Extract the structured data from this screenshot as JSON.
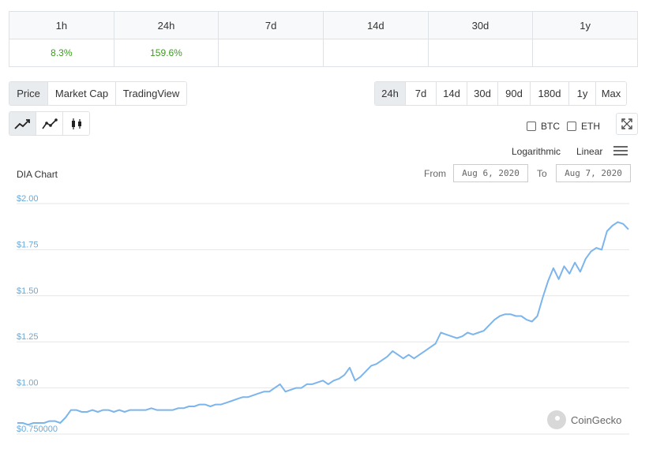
{
  "performance": {
    "headers": [
      "1h",
      "24h",
      "7d",
      "14d",
      "30d",
      "1y"
    ],
    "values": [
      "8.3%",
      "159.6%",
      "",
      "",
      "",
      ""
    ],
    "positive_color": "#3c9c1f"
  },
  "tabs": [
    {
      "label": "Price",
      "active": true
    },
    {
      "label": "Market Cap",
      "active": false
    },
    {
      "label": "TradingView",
      "active": false
    }
  ],
  "ranges": [
    {
      "label": "24h",
      "active": true
    },
    {
      "label": "7d",
      "active": false
    },
    {
      "label": "14d",
      "active": false
    },
    {
      "label": "30d",
      "active": false
    },
    {
      "label": "90d",
      "active": false
    },
    {
      "label": "180d",
      "active": false
    },
    {
      "label": "1y",
      "active": false
    },
    {
      "label": "Max",
      "active": false
    }
  ],
  "chart_types": [
    "line-chart-icon",
    "line-markers-icon",
    "candlestick-icon"
  ],
  "compare": {
    "btc_label": "BTC",
    "eth_label": "ETH"
  },
  "scale": {
    "log_label": "Logarithmic",
    "linear_label": "Linear"
  },
  "chart_title": "DIA Chart",
  "range": {
    "from_label": "From",
    "from_value": "Aug 6, 2020",
    "to_label": "To",
    "to_value": "Aug 7, 2020"
  },
  "brand": "CoinGecko",
  "chart_data": {
    "type": "line",
    "title": "DIA Chart",
    "line_color": "#7cb5ec",
    "axis_label_color": "#6aa9d8",
    "ylim": [
      0.75,
      2.0
    ],
    "yticks": [
      {
        "value": 2.0,
        "label": "$2.00"
      },
      {
        "value": 1.75,
        "label": "$1.75"
      },
      {
        "value": 1.5,
        "label": "$1.50"
      },
      {
        "value": 1.25,
        "label": "$1.25"
      },
      {
        "value": 1.0,
        "label": "$1.00"
      },
      {
        "value": 0.75,
        "label": "$0.750000"
      }
    ],
    "x_range_label": "Aug 6, 2020 – Aug 7, 2020",
    "series": [
      {
        "values": [
          0.81,
          0.81,
          0.8,
          0.81,
          0.81,
          0.81,
          0.82,
          0.82,
          0.81,
          0.84,
          0.88,
          0.88,
          0.87,
          0.87,
          0.88,
          0.87,
          0.88,
          0.88,
          0.87,
          0.88,
          0.87,
          0.88,
          0.88,
          0.88,
          0.88,
          0.89,
          0.88,
          0.88,
          0.88,
          0.88,
          0.89,
          0.89,
          0.9,
          0.9,
          0.91,
          0.91,
          0.9,
          0.91,
          0.91,
          0.92,
          0.93,
          0.94,
          0.95,
          0.95,
          0.96,
          0.97,
          0.98,
          0.98,
          1.0,
          1.02,
          0.98,
          0.99,
          1.0,
          1.0,
          1.02,
          1.02,
          1.03,
          1.04,
          1.02,
          1.04,
          1.05,
          1.07,
          1.11,
          1.04,
          1.06,
          1.09,
          1.12,
          1.13,
          1.15,
          1.17,
          1.2,
          1.18,
          1.16,
          1.18,
          1.16,
          1.18,
          1.2,
          1.22,
          1.24,
          1.3,
          1.29,
          1.28,
          1.27,
          1.28,
          1.3,
          1.29,
          1.3,
          1.31,
          1.34,
          1.37,
          1.39,
          1.4,
          1.4,
          1.39,
          1.39,
          1.37,
          1.36,
          1.39,
          1.49,
          1.58,
          1.65,
          1.59,
          1.66,
          1.62,
          1.68,
          1.63,
          1.7,
          1.74,
          1.76,
          1.75,
          1.85,
          1.88,
          1.9,
          1.89,
          1.86
        ]
      }
    ]
  }
}
